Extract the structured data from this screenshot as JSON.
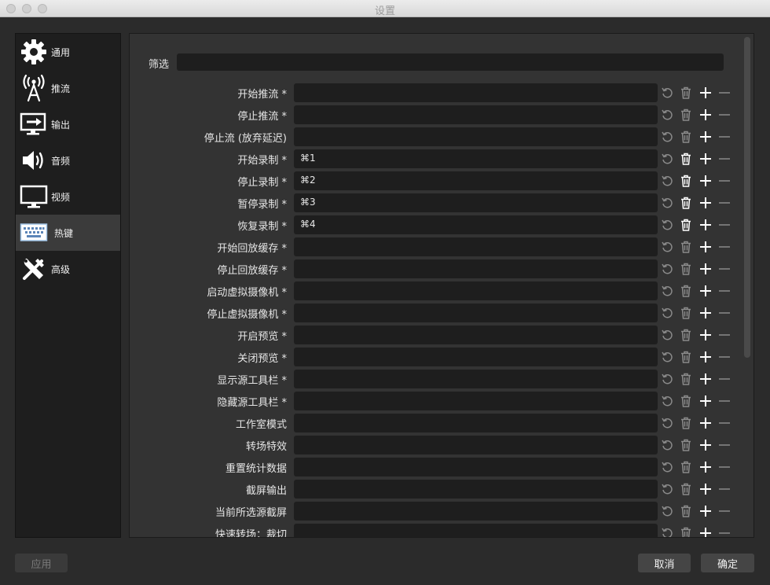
{
  "window": {
    "title": "设置"
  },
  "sidebar": {
    "items": [
      {
        "label": "通用",
        "icon": "gear-icon"
      },
      {
        "label": "推流",
        "icon": "broadcast-tower-icon"
      },
      {
        "label": "输出",
        "icon": "output-monitor-icon"
      },
      {
        "label": "音频",
        "icon": "speaker-icon"
      },
      {
        "label": "视频",
        "icon": "monitor-icon"
      },
      {
        "label": "热键",
        "icon": "keyboard-icon",
        "active": true
      },
      {
        "label": "高级",
        "icon": "tools-icon"
      }
    ]
  },
  "filter": {
    "label": "筛选",
    "value": ""
  },
  "hotkeys": [
    {
      "label": "开始推流 *",
      "value": "",
      "trash_active": false
    },
    {
      "label": "停止推流 *",
      "value": "",
      "trash_active": false
    },
    {
      "label": "停止流 (放弃延迟)",
      "value": "",
      "trash_active": false
    },
    {
      "label": "开始录制 *",
      "value": "⌘1",
      "trash_active": true
    },
    {
      "label": "停止录制 *",
      "value": "⌘2",
      "trash_active": true
    },
    {
      "label": "暂停录制 *",
      "value": "⌘3",
      "trash_active": true
    },
    {
      "label": "恢复录制 *",
      "value": "⌘4",
      "trash_active": true
    },
    {
      "label": "开始回放缓存 *",
      "value": "",
      "trash_active": false
    },
    {
      "label": "停止回放缓存 *",
      "value": "",
      "trash_active": false
    },
    {
      "label": "启动虚拟摄像机 *",
      "value": "",
      "trash_active": false
    },
    {
      "label": "停止虚拟摄像机 *",
      "value": "",
      "trash_active": false
    },
    {
      "label": "开启预览 *",
      "value": "",
      "trash_active": false
    },
    {
      "label": "关闭预览 *",
      "value": "",
      "trash_active": false
    },
    {
      "label": "显示源工具栏 *",
      "value": "",
      "trash_active": false
    },
    {
      "label": "隐藏源工具栏 *",
      "value": "",
      "trash_active": false
    },
    {
      "label": "工作室模式",
      "value": "",
      "trash_active": false
    },
    {
      "label": "转场特效",
      "value": "",
      "trash_active": false
    },
    {
      "label": "重置统计数据",
      "value": "",
      "trash_active": false
    },
    {
      "label": "截屏输出",
      "value": "",
      "trash_active": false
    },
    {
      "label": "当前所选源截屏",
      "value": "",
      "trash_active": false
    },
    {
      "label": "快速转场：裁切",
      "value": "",
      "trash_active": false
    }
  ],
  "buttons": {
    "apply": "应用",
    "cancel": "取消",
    "ok": "确定"
  },
  "colors": {
    "icon_active": "#ffffff",
    "icon_inactive": "#8a8a8a"
  }
}
